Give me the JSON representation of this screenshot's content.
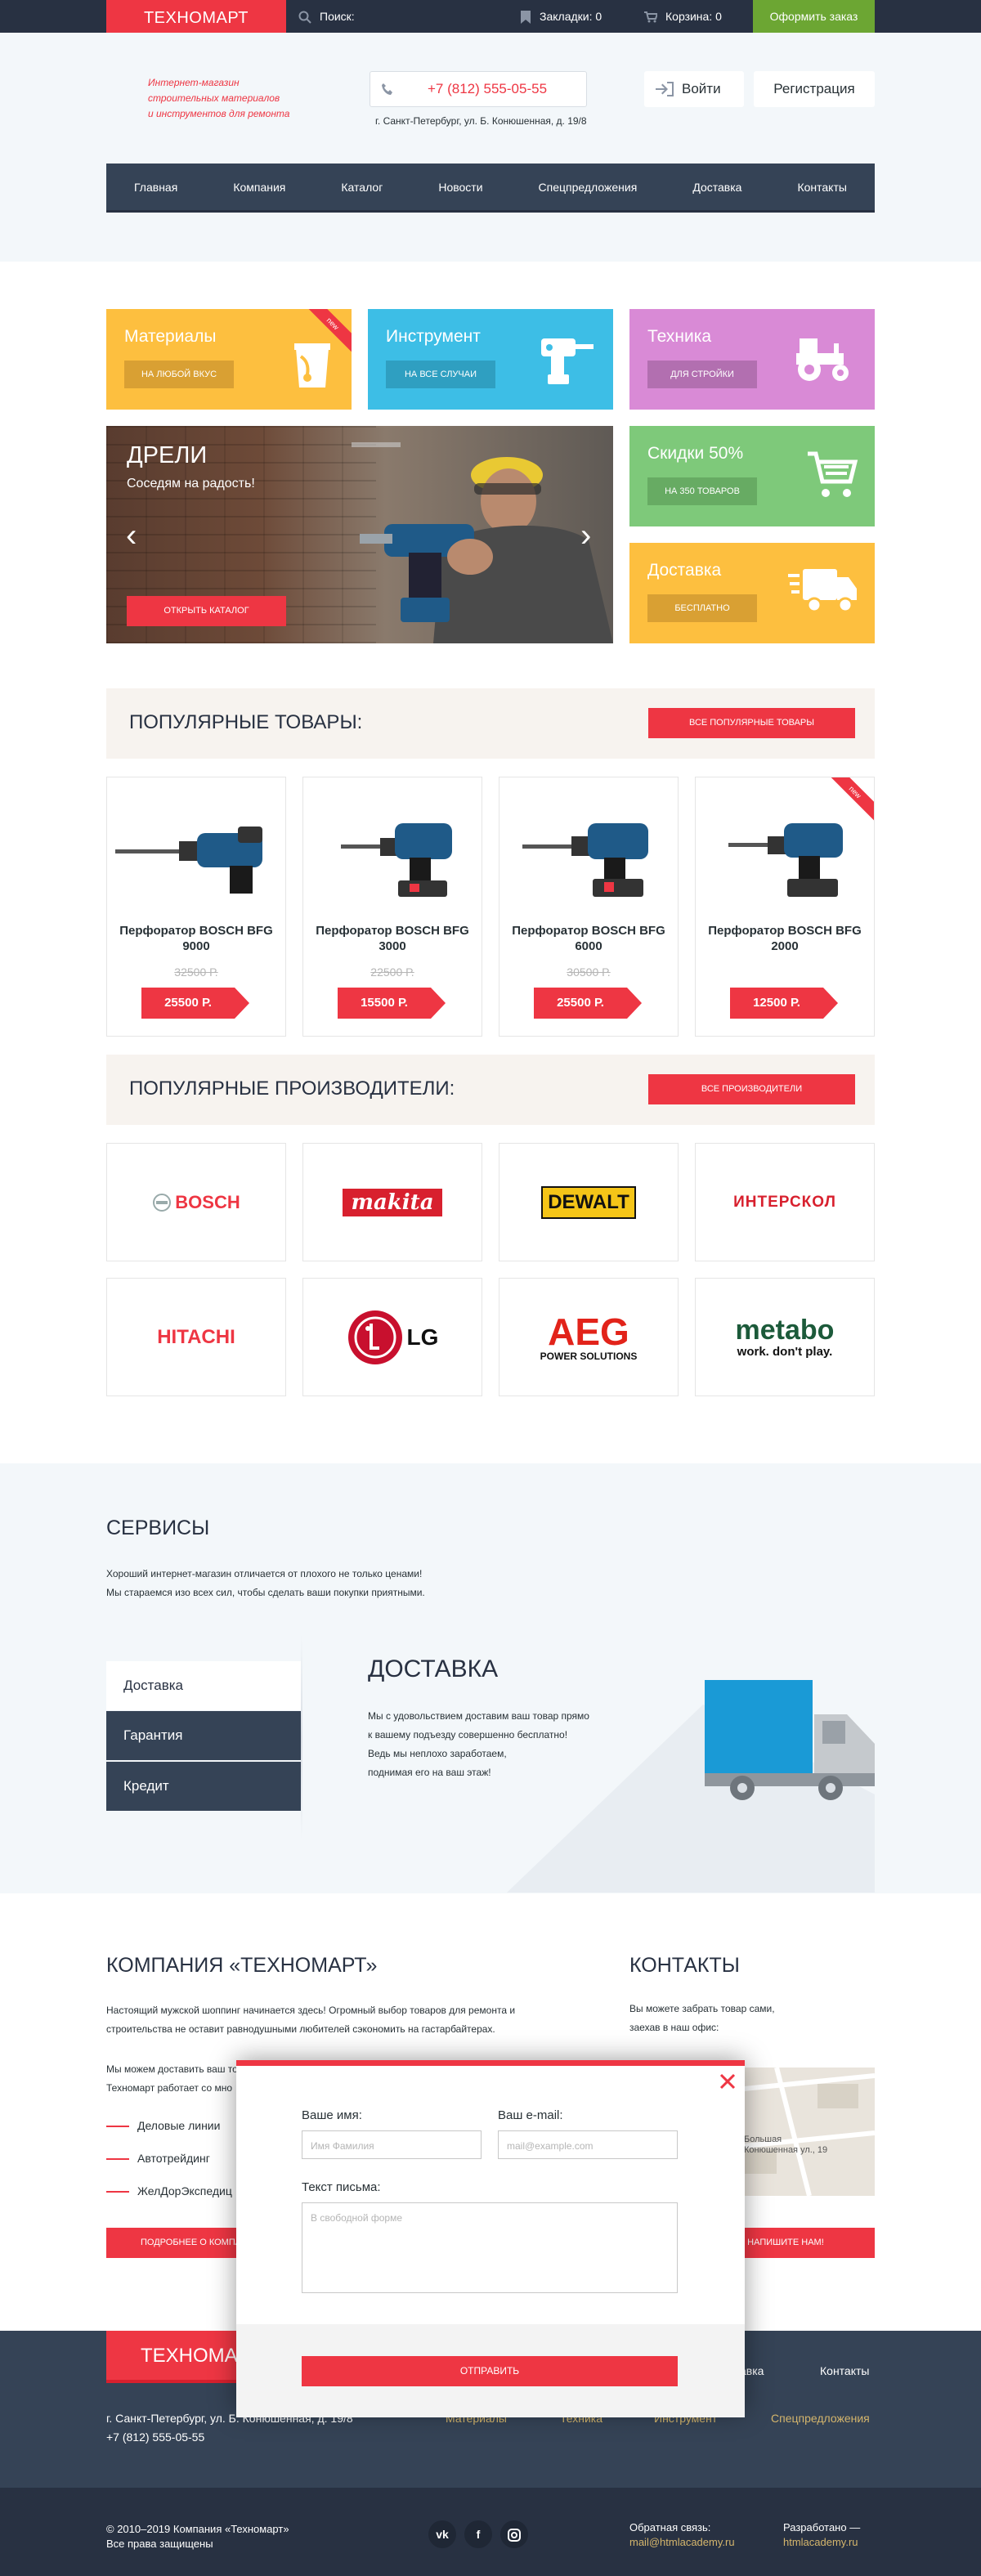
{
  "topbar": {
    "logo": "ТЕХНОМАРТ",
    "search_label": "Поиск:",
    "bookmarks": "Закладки: 0",
    "cart": "Корзина: 0",
    "order": "Оформить заказ"
  },
  "header": {
    "slogan": [
      "Интернет-магазин",
      "строительных материалов",
      "и инструментов для ремонта"
    ],
    "phone": "+7 (812) 555-05-55",
    "address": "г. Санкт-Петербург, ул. Б. Конюшенная, д. 19/8",
    "login": "Войти",
    "register": "Регистрация"
  },
  "nav": [
    "Главная",
    "Компания",
    "Каталог",
    "Новости",
    "Спецпредложения",
    "Доставка",
    "Контакты"
  ],
  "tiles": [
    {
      "title": "Материалы",
      "button": "На любой вкус",
      "ribbon": "new",
      "color": "#fdbf3f",
      "btn_color": "#d9a033"
    },
    {
      "title": "Инструмент",
      "button": "На все случаи",
      "color": "#3dbee6",
      "btn_color": "#2f9fc1"
    },
    {
      "title": "Техника",
      "button": "Для стройки",
      "color": "#d98ad6",
      "btn_color": "#b26fb0"
    },
    {
      "title": "Скидки 50%",
      "button": "На 350 товаров",
      "color": "#7ec97a",
      "btn_color": "#67ab63"
    },
    {
      "title": "Доставка",
      "button": "Бесплатно",
      "color": "#fdbf3f",
      "btn_color": "#d9a033"
    }
  ],
  "slider": {
    "title": "ДРЕЛИ",
    "subtitle": "Соседям на радость!",
    "button": "Открыть каталог"
  },
  "popular": {
    "heading": "ПОПУЛЯРНЫЕ ТОВАРЫ:",
    "button": "Все популярные товары",
    "products": [
      {
        "name": "Перфоратор BOSCH BFG 9000",
        "old_price": "32500 Р.",
        "price": "25500 Р."
      },
      {
        "name": "Перфоратор BOSCH BFG 3000",
        "old_price": "22500 Р.",
        "price": "15500 Р."
      },
      {
        "name": "Перфоратор BOSCH BFG 6000",
        "old_price": "30500 Р.",
        "price": "25500 Р."
      },
      {
        "name": "Перфоратор BOSCH BFG 2000",
        "old_price": "",
        "price": "12500 Р.",
        "ribbon": "new"
      }
    ]
  },
  "brands": {
    "heading": "ПОПУЛЯРНЫЕ ПРОИЗВОДИТЕЛИ:",
    "button": "Все производители",
    "items": [
      "BOSCH",
      "makita",
      "DEWALT",
      "ИНТЕРСКОЛ",
      "HITACHI",
      "LG",
      "AEG",
      "metabo"
    ],
    "aeg_sub": "POWER SOLUTIONS",
    "metabo_sub": "work. don't play."
  },
  "services": {
    "heading": "СЕРВИСЫ",
    "text": [
      "Хороший интернет-магазин отличается от плохого не только ценами!",
      "Мы стараемся изо всех сил, чтобы сделать ваши покупки приятными."
    ],
    "tabs": [
      "Доставка",
      "Гарантия",
      "Кредит"
    ],
    "delivery_heading": "ДОСТАВКА",
    "delivery_text": [
      "Мы с удовольствием доставим ваш товар прямо",
      "к вашему подъезду совершенно бесплатно!",
      "Ведь мы неплохо заработаем,",
      "поднимая его на ваш этаж!"
    ]
  },
  "company": {
    "heading": "КОМПАНИЯ «ТЕХНОМАРТ»",
    "text1": [
      "Настоящий мужской шоппинг начинается здесь! Огромный выбор товаров для ремонта и",
      "строительства не оставит равнодушными любителей сэкономить на гастарбайтерах."
    ],
    "text2": [
      "Мы можем доставить ваш то",
      "Техномарт работает со мно"
    ],
    "partners": [
      "Деловые линии",
      "Автотрейдинг",
      "ЖелДорЭкспедиц"
    ],
    "button": "Подробнее о компа"
  },
  "contacts": {
    "heading": "КОНТАКТЫ",
    "text": [
      "Вы можете забрать товар сами,",
      "заехав в наш офис:"
    ],
    "map_label": [
      "Большая",
      "Конюшенная ул., 19"
    ],
    "button": "2 напишите нам!"
  },
  "modal": {
    "name_label": "Ваше имя:",
    "name_placeholder": "Имя Фамилия",
    "email_label": "Ваш e-mail:",
    "email_placeholder": "mail@example.com",
    "message_label": "Текст письма:",
    "message_placeholder": "В свободной форме",
    "send": "Отправить"
  },
  "footer": {
    "logo": "ТЕХНОМАР",
    "links_top": [
      "авка",
      "Контакты"
    ],
    "address": "г. Санкт-Петербург, ул. Б. Конюшенная, д. 19/8",
    "phone": "+7 (812) 555-05-55",
    "links_bottom": [
      "Материалы",
      "Техника",
      "Инструмент",
      "Спецпредложения"
    ],
    "copyright": [
      "© 2010–2019 Компания «Техномарт»",
      "Все права защищены"
    ],
    "social": [
      "vk-icon",
      "facebook-icon",
      "instagram-icon"
    ],
    "feedback_label": "Обратная связь:",
    "feedback_email": "mail@htmlacademy.ru",
    "dev_label": "Разработано —",
    "dev_link": "htmlacademy.ru"
  }
}
